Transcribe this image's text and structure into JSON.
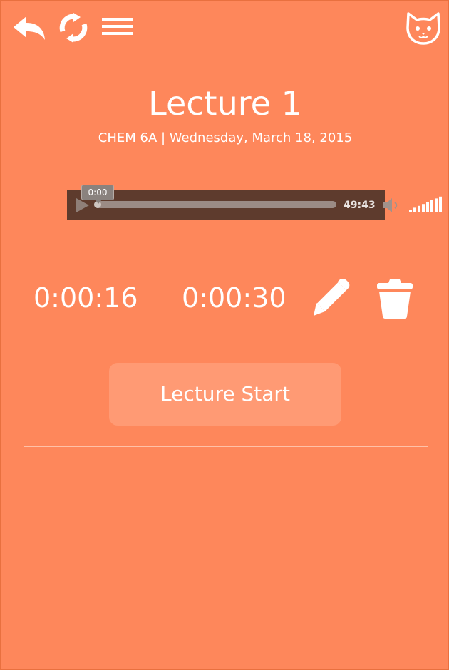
{
  "header": {
    "back_icon": "back-arrow-icon",
    "refresh_icon": "refresh-icon",
    "menu_icon": "hamburger-menu-icon",
    "profile_icon": "cat-face-icon"
  },
  "lecture": {
    "title": "Lecture 1",
    "subtitle": "CHEM 6A | Wednesday, March 18, 2015"
  },
  "player": {
    "current_time": "0:00",
    "duration": "49:43",
    "progress": 0.0,
    "volume_level": 1.0
  },
  "clip": {
    "start_time": "0:00:16",
    "end_time": "0:00:30",
    "edit_icon": "pencil-icon",
    "delete_icon": "trash-icon"
  },
  "actions": {
    "lecture_start_label": "Lecture Start"
  },
  "colors": {
    "background": "#fe875b",
    "button_bg": "#ff9a74",
    "player_bg": "#5e3b2d",
    "text": "#ffffff"
  }
}
